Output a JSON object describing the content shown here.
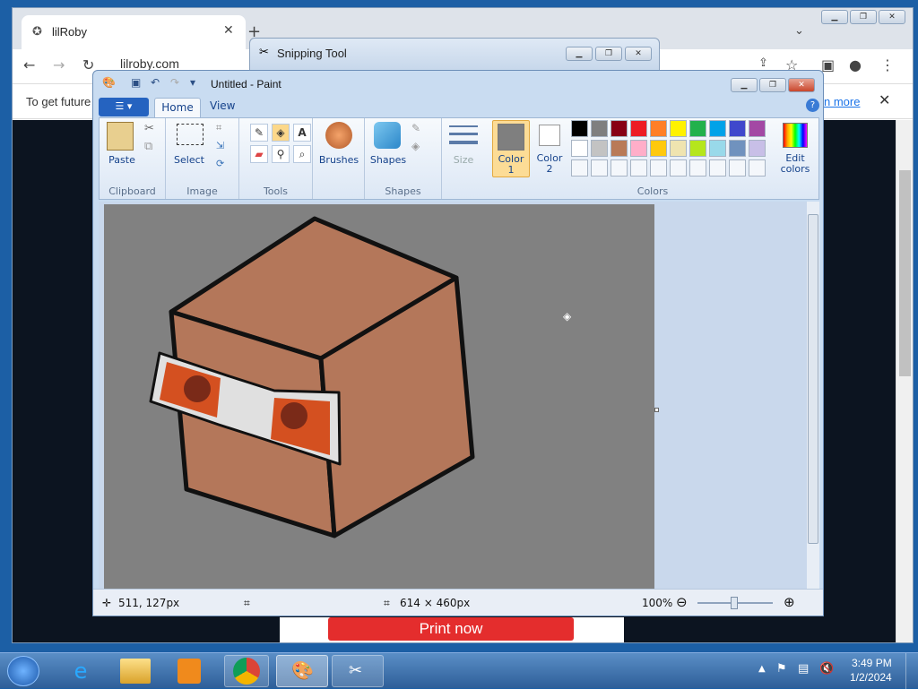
{
  "browser": {
    "tab_title": "lilRoby",
    "url": "lilroby.com",
    "info_text": "To get future",
    "info_link": "n more",
    "print_button": "Print now"
  },
  "snipping_tool": {
    "title": "Snipping Tool"
  },
  "paint": {
    "title": "Untitled - Paint",
    "tabs": [
      "Home",
      "View"
    ],
    "groups": {
      "clipboard": {
        "label": "Clipboard",
        "paste": "Paste"
      },
      "image": {
        "label": "Image",
        "select": "Select"
      },
      "tools": {
        "label": "Tools"
      },
      "brushes": {
        "label": "Brushes"
      },
      "shapes": {
        "label": "Shapes",
        "button": "Shapes",
        "size": "Size"
      },
      "colors": {
        "label": "Colors",
        "color1": "Color",
        "color1_num": "1",
        "color2": "Color",
        "color2_num": "2",
        "edit": "Edit",
        "edit2": "colors"
      }
    },
    "palette_row1": [
      "#000000",
      "#7f7f7f",
      "#880015",
      "#ed1c24",
      "#ff7f27",
      "#fff200",
      "#22b14c",
      "#00a2e8",
      "#3f48cc",
      "#a349a4"
    ],
    "palette_row2": [
      "#ffffff",
      "#c3c3c3",
      "#b97a57",
      "#ffaec9",
      "#ffc90e",
      "#efe4b0",
      "#b5e61d",
      "#99d9ea",
      "#7092be",
      "#c8bfe7"
    ],
    "color1_value": "#7f7f7f",
    "status": {
      "cursor_pos": "511, 127px",
      "canvas_size": "614 × 460px",
      "zoom": "100%"
    }
  },
  "taskbar": {
    "time": "3:49 PM",
    "date": "1/2/2024"
  }
}
